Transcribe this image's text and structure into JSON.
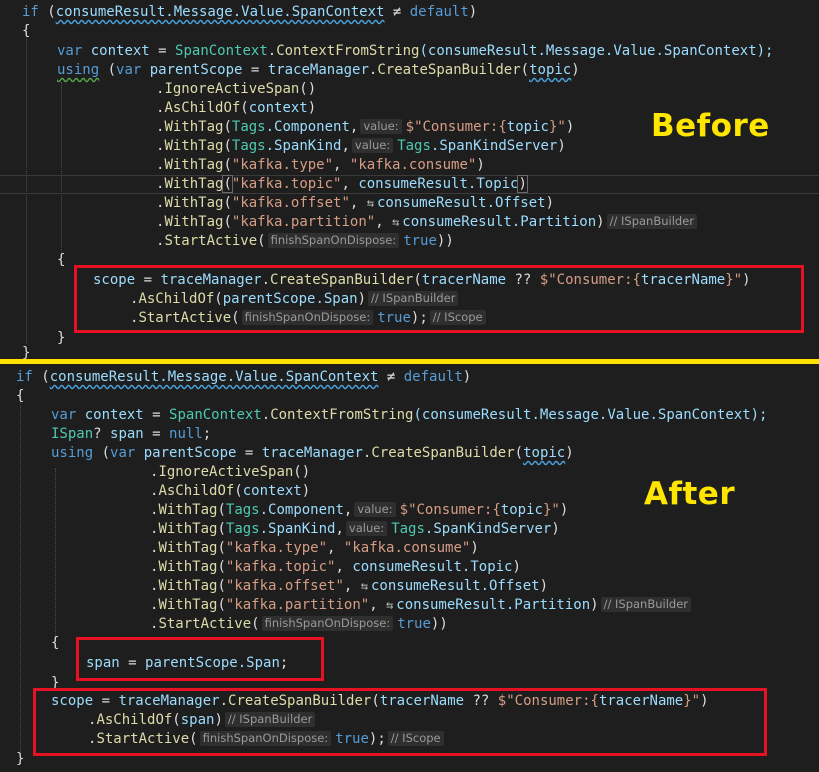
{
  "labels": {
    "before": "Before",
    "after": "After"
  },
  "colors": {
    "keyword": "#569cd6",
    "type": "#4ec9b0",
    "method": "#dcdcaa",
    "string": "#d69d85",
    "identifier": "#9cdcfe",
    "highlight_box": "#e81123",
    "label": "#ffe600"
  },
  "icons": {
    "param_hint": "box-arrow-icon"
  },
  "before": {
    "l1": {
      "kw_if": "if",
      "open": " (",
      "expr": "consumeResult.Message.Value.SpanContext",
      "neq": " ≠ ",
      "default": "default",
      "close": ")"
    },
    "l2": "{",
    "l3": {
      "kw": "var",
      "name": " context",
      "eq": " = ",
      "type": "SpanContext",
      "dot": ".",
      "fn": "ContextFromString",
      "arg": "(consumeResult.Message.Value.SpanContext);"
    },
    "l4": {
      "kw_using": "using",
      "open": " (",
      "kw_var": "var",
      "name": " parentScope",
      "eq": " = ",
      "obj": "traceManager",
      "dot": ".",
      "fn": "CreateSpanBuilder",
      "p1": "(",
      "arg": "topic",
      "p2": ")"
    },
    "l5": {
      "dot": ".",
      "fn": "IgnoreActiveSpan",
      "rest": "()"
    },
    "l6": {
      "dot": ".",
      "fn": "AsChildOf",
      "p1": "(",
      "arg": "context",
      "p2": ")"
    },
    "l7": {
      "dot": ".",
      "fn": "WithTag",
      "p1": "(",
      "type": "Tags",
      "prop": ".Component",
      "comma": ",",
      "hint": "value:",
      "str": "$\"Consumer:{",
      "arg": "topic",
      "str2": "}\"",
      "p2": ")"
    },
    "l8": {
      "dot": ".",
      "fn": "WithTag",
      "p1": "(",
      "type": "Tags",
      "prop": ".SpanKind",
      "comma": ",",
      "hint": "value:",
      "type2": "Tags",
      "prop2": ".SpanKindServer",
      "p2": ")"
    },
    "l9": {
      "dot": ".",
      "fn": "WithTag",
      "p1": "(",
      "s1": "\"kafka.type\"",
      "comma": ", ",
      "s2": "\"kafka.consume\"",
      "p2": ")"
    },
    "l10": {
      "dot": ".",
      "fn": "WithTag",
      "p1": "(",
      "s1": "\"kafka.topic\"",
      "comma": ", ",
      "arg": "consumeResult.Topic",
      "p2": ")"
    },
    "l11": {
      "dot": ".",
      "fn": "WithTag",
      "p1": "(",
      "s1": "\"kafka.offset\"",
      "comma": ", ",
      "arg": "consumeResult.Offset",
      "p2": ")"
    },
    "l12": {
      "dot": ".",
      "fn": "WithTag",
      "p1": "(",
      "s1": "\"kafka.partition\"",
      "comma": ", ",
      "arg": "consumeResult.Partition",
      "p2": ")",
      "hint": "// ISpanBuilder"
    },
    "l13": {
      "dot": ".",
      "fn": "StartActive",
      "p1": "(",
      "hint": "finishSpanOnDispose:",
      "kw": "true",
      "p2": "))"
    },
    "l14": "{",
    "l15": {
      "name": "scope",
      "eq": " = ",
      "obj": "traceManager",
      "dot": ".",
      "fn": "CreateSpanBuilder",
      "p1": "(",
      "arg": "tracerName",
      "op": " ?? ",
      "str": "$\"Consumer:{",
      "arg2": "tracerName",
      "str2": "}\"",
      "p2": ")"
    },
    "l16": {
      "dot": ".",
      "fn": "AsChildOf",
      "p1": "(",
      "arg": "parentScope.Span",
      "p2": ")",
      "hint": "// ISpanBuilder"
    },
    "l17": {
      "dot": ".",
      "fn": "StartActive",
      "p1": "(",
      "hint": "finishSpanOnDispose:",
      "kw": "true",
      "p2": ");",
      "hint2": "// IScope"
    },
    "l18": "}",
    "l19": "}"
  },
  "after": {
    "l1": {
      "kw_if": "if",
      "open": " (",
      "expr": "consumeResult.Message.Value.SpanContext",
      "neq": " ≠ ",
      "default": "default",
      "close": ")"
    },
    "l2": "{",
    "l3": {
      "kw": "var",
      "name": " context",
      "eq": " = ",
      "type": "SpanContext",
      "dot": ".",
      "fn": "ContextFromString",
      "arg": "(consumeResult.Message.Value.SpanContext);"
    },
    "l4": {
      "type": "ISpan",
      "q": "?",
      "name": " span",
      "eq": " = ",
      "kw": "null",
      "semi": ";"
    },
    "l5": {
      "kw_using": "using",
      "open": " (",
      "kw_var": "var",
      "name": " parentScope",
      "eq": " = ",
      "obj": "traceManager",
      "dot": ".",
      "fn": "CreateSpanBuilder",
      "p1": "(",
      "arg": "topic",
      "p2": ")"
    },
    "l6": {
      "dot": ".",
      "fn": "IgnoreActiveSpan",
      "rest": "()"
    },
    "l7": {
      "dot": ".",
      "fn": "AsChildOf",
      "p1": "(",
      "arg": "context",
      "p2": ")"
    },
    "l8": {
      "dot": ".",
      "fn": "WithTag",
      "p1": "(",
      "type": "Tags",
      "prop": ".Component",
      "comma": ",",
      "hint": "value:",
      "str": "$\"Consumer:{",
      "arg": "topic",
      "str2": "}\"",
      "p2": ")"
    },
    "l9": {
      "dot": ".",
      "fn": "WithTag",
      "p1": "(",
      "type": "Tags",
      "prop": ".SpanKind",
      "comma": ",",
      "hint": "value:",
      "type2": "Tags",
      "prop2": ".SpanKindServer",
      "p2": ")"
    },
    "l10": {
      "dot": ".",
      "fn": "WithTag",
      "p1": "(",
      "s1": "\"kafka.type\"",
      "comma": ", ",
      "s2": "\"kafka.consume\"",
      "p2": ")"
    },
    "l11": {
      "dot": ".",
      "fn": "WithTag",
      "p1": "(",
      "s1": "\"kafka.topic\"",
      "comma": ", ",
      "arg": "consumeResult.Topic",
      "p2": ")"
    },
    "l12": {
      "dot": ".",
      "fn": "WithTag",
      "p1": "(",
      "s1": "\"kafka.offset\"",
      "comma": ", ",
      "arg": "consumeResult.Offset",
      "p2": ")"
    },
    "l13": {
      "dot": ".",
      "fn": "WithTag",
      "p1": "(",
      "s1": "\"kafka.partition\"",
      "comma": ", ",
      "arg": "consumeResult.Partition",
      "p2": ")",
      "hint": "// ISpanBuilder"
    },
    "l14": {
      "dot": ".",
      "fn": "StartActive",
      "p1": "(",
      "hint": "finishSpanOnDispose:",
      "kw": "true",
      "p2": "))"
    },
    "l15": "{",
    "l16": {
      "name": "span",
      "eq": " = ",
      "obj": "parentScope",
      "prop": ".Span",
      "semi": ";"
    },
    "l17": "}",
    "l18": {
      "name": "scope",
      "eq": " = ",
      "obj": "traceManager",
      "dot": ".",
      "fn": "CreateSpanBuilder",
      "p1": "(",
      "arg": "tracerName",
      "op": " ?? ",
      "str": "$\"Consumer:{",
      "arg2": "tracerName",
      "str2": "}\"",
      "p2": ")"
    },
    "l19": {
      "dot": ".",
      "fn": "AsChildOf",
      "p1": "(",
      "arg": "span",
      "p2": ")",
      "hint": "// ISpanBuilder"
    },
    "l20": {
      "dot": ".",
      "fn": "StartActive",
      "p1": "(",
      "hint": "finishSpanOnDispose:",
      "kw": "true",
      "p2": ");",
      "hint2": "// IScope"
    },
    "l21": "}"
  }
}
